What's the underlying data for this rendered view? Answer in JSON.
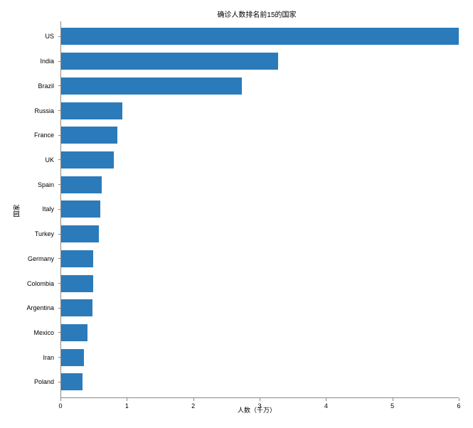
{
  "chart_data": {
    "type": "bar",
    "orientation": "horizontal",
    "title": "确诊人数排名前15的国家",
    "xlabel": "人数（千万）",
    "ylabel": "国家",
    "xlim": [
      0,
      6
    ],
    "ylim_categories": 15,
    "x_ticks": [
      0,
      1,
      2,
      3,
      4,
      5,
      6
    ],
    "categories": [
      "US",
      "India",
      "Brazil",
      "Russia",
      "France",
      "UK",
      "Spain",
      "Italy",
      "Turkey",
      "Germany",
      "Colombia",
      "Argentina",
      "Mexico",
      "Iran",
      "Poland"
    ],
    "values": [
      6.03,
      3.27,
      2.72,
      0.92,
      0.85,
      0.79,
      0.61,
      0.59,
      0.57,
      0.48,
      0.48,
      0.47,
      0.4,
      0.34,
      0.32
    ],
    "bar_color": "#2b7bba"
  }
}
